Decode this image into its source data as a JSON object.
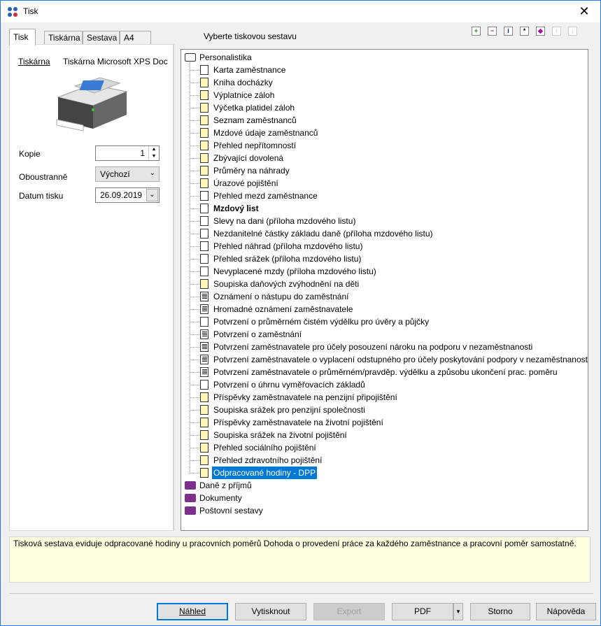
{
  "window": {
    "title": "Tisk",
    "close_glyph": "✕"
  },
  "tabs": [
    {
      "label": "Tisk",
      "active": true
    },
    {
      "label": "Tiskárna",
      "active": false
    },
    {
      "label": "Sestava",
      "active": false
    },
    {
      "label": "A4",
      "active": false
    }
  ],
  "left": {
    "printer_link": "Tiskárna",
    "printer_name": "Tiskárna Microsoft XPS Doc",
    "copies_label": "Kopie",
    "copies_value": "1",
    "duplex_label": "Oboustranně",
    "duplex_value": "Výchozí",
    "date_label": "Datum tisku",
    "date_value": "26.09.2019"
  },
  "tree_title": "Vyberte tiskovou sestavu",
  "toolbar_icons": [
    "expand-icon",
    "collapse-icon",
    "info-icon",
    "star-icon",
    "favorite-icon",
    "move-up-icon",
    "move-down-icon"
  ],
  "tree": {
    "root": "Personalistika",
    "items": [
      {
        "label": "Karta zaměstnance",
        "icon": "doc"
      },
      {
        "label": "Kniha docházky",
        "icon": "doc-yellow"
      },
      {
        "label": "Výplatnice záloh",
        "icon": "doc-yellow"
      },
      {
        "label": "Výčetka platidel záloh",
        "icon": "doc-yellow"
      },
      {
        "label": "Seznam zaměstnanců",
        "icon": "doc-yellow"
      },
      {
        "label": "Mzdové údaje zaměstnanců",
        "icon": "doc-yellow"
      },
      {
        "label": "Přehled nepřítomností",
        "icon": "doc-yellow"
      },
      {
        "label": "Zbývající dovolená",
        "icon": "doc-yellow"
      },
      {
        "label": "Průměry na náhrady",
        "icon": "doc-yellow"
      },
      {
        "label": "Úrazové pojištění",
        "icon": "doc-yellow"
      },
      {
        "label": "Přehled mezd zaměstnance",
        "icon": "doc"
      },
      {
        "label": "Mzdový list",
        "icon": "doc",
        "bold": true
      },
      {
        "label": "Slevy na dani (příloha mzdového listu)",
        "icon": "doc"
      },
      {
        "label": "Nezdanitelné částky základu daně (příloha mzdového listu)",
        "icon": "doc"
      },
      {
        "label": "Přehled náhrad (příloha mzdového listu)",
        "icon": "doc"
      },
      {
        "label": "Přehled srážek (příloha mzdového listu)",
        "icon": "doc"
      },
      {
        "label": "Nevyplacené mzdy (příloha mzdového listu)",
        "icon": "doc"
      },
      {
        "label": "Soupiska daňových zvýhodnění na děti",
        "icon": "doc-yellow"
      },
      {
        "label": "Oznámení o nástupu do zaměstnání",
        "icon": "doc-form"
      },
      {
        "label": "Hromadné oznámení zaměstnavatele",
        "icon": "doc-form"
      },
      {
        "label": "Potvrzení o průměrném čistém výdělku pro úvěry a půjčky",
        "icon": "doc"
      },
      {
        "label": "Potvrzení o zaměstnání",
        "icon": "doc-form"
      },
      {
        "label": "Potvrzení zaměstnavatele pro účely posouzení nároku na podporu v nezaměstnanosti",
        "icon": "doc-form"
      },
      {
        "label": "Potvrzení zaměstnavatele o vyplacení odstupného pro účely poskytování podpory v nezaměstnanosti",
        "icon": "doc-form"
      },
      {
        "label": "Potvrzení zaměstnavatele o průměrném/pravděp. výdělku a způsobu ukončení prac. poměru",
        "icon": "doc-form"
      },
      {
        "label": "Potvrzení o úhrnu vyměřovacích základů",
        "icon": "doc"
      },
      {
        "label": "Příspěvky zaměstnavatele na penzijní připojištění",
        "icon": "doc-yellow"
      },
      {
        "label": "Soupiska srážek pro penzijní společnosti",
        "icon": "doc-yellow"
      },
      {
        "label": "Příspěvky zaměstnavatele na životní pojištění",
        "icon": "doc-yellow"
      },
      {
        "label": "Soupiska srážek na životní pojištění",
        "icon": "doc-yellow"
      },
      {
        "label": "Přehled sociálního pojištění",
        "icon": "doc-yellow"
      },
      {
        "label": "Přehled zdravotního pojištění",
        "icon": "doc-yellow"
      },
      {
        "label": "Odpracované hodiny - DPP",
        "icon": "doc-yellow",
        "selected": true
      }
    ],
    "groups": [
      "Daně z příjmů",
      "Dokumenty",
      "Poštovní sestavy"
    ]
  },
  "description": "Tisková sestava eviduje odpracované hodiny u pracovních poměrů Dohoda o provedení práce za každého zaměstnance a pracovní poměr samostatně.",
  "buttons": {
    "preview": "Náhled",
    "print": "Vytisknout",
    "export": "Export",
    "pdf": "PDF",
    "cancel": "Storno",
    "help": "Nápověda"
  }
}
